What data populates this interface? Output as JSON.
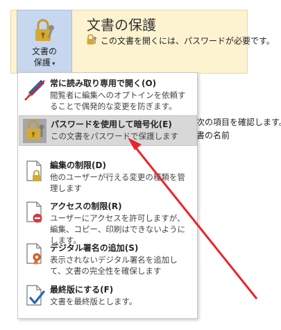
{
  "colors": {
    "panel_bg": "#fdf3d0",
    "button_bg": "#c6d7ee",
    "highlight": "#d8d8d8",
    "arrow": "#e8252a",
    "lock_gold": "#d4a935"
  },
  "ribbon": {
    "protect_button": {
      "line1": "文書の",
      "line2": "保護",
      "icon": "lock-key-icon"
    },
    "title": "文書の保護",
    "description": "この文書を開くには、パスワードが必要です。"
  },
  "background": {
    "line1": "次の項目を確認します。",
    "line2": "書の名前"
  },
  "menu": {
    "items": [
      {
        "title": "常に読み取り専用で開く(O)",
        "desc": "閲覧者に編集へのオプトインを依頼することで偶発的な変更を防ぎます。",
        "icon": "pencil-icon"
      },
      {
        "title": "パスワードを使用して暗号化(E)",
        "desc": "この文書をパスワードで保護します",
        "icon": "lock-key-icon"
      },
      {
        "title": "編集の制限(D)",
        "desc": "他のユーザーが行える変更の種類を管理します",
        "icon": "document-lock-icon"
      },
      {
        "title": "アクセスの制限(R)",
        "desc": "ユーザーにアクセスを許可しますが、編集、コピー、印刷はできないようにします。",
        "icon": "document-restrict-icon"
      },
      {
        "title": "デジタル署名の追加(S)",
        "desc": "表示されないデジタル署名を追加して、文書の完全性を確保します",
        "icon": "document-signature-icon"
      },
      {
        "title": "最終版にする(F)",
        "desc": "文書を最終版とします。",
        "icon": "document-check-icon"
      }
    ]
  }
}
